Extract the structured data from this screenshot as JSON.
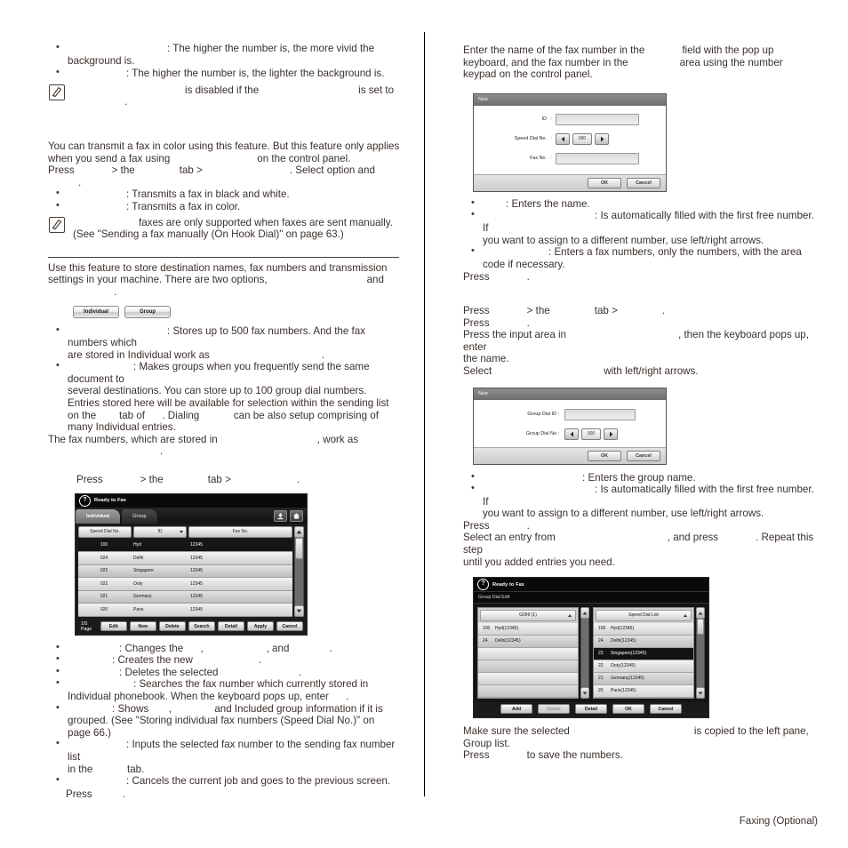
{
  "document": {
    "footer": "Faxing (Optional)"
  },
  "left_column": {
    "bullets_top": [
      {
        "pre_gap": 14,
        "text": ": The higher the number is, the more vivid the background is."
      },
      {
        "pre_gap": 8,
        "text": ": The higher the number is, the lighter the background is."
      }
    ],
    "note_top": {
      "segments": [
        "",
        "is disabled if the",
        "is set to",
        "."
      ]
    },
    "color_mode": {
      "para1": "You can transmit a fax in color using this feature. But this feature only applies when you send a fax using",
      "para1_tail": "on the control panel.",
      "press_line": {
        "press": "Press",
        "gt1": "> the",
        "tab": "tab >",
        "tail": ". Select option and",
        "end": "."
      },
      "bullets": [
        {
          "text": ": Transmits a fax in black and white."
        },
        {
          "text": ": Transmits a fax in color."
        }
      ],
      "note": {
        "line1_tail": "faxes are only supported when faxes are sent manually.",
        "line2": "(See \"Sending a fax manually (On Hook Dial)\" on page 63.)"
      }
    },
    "phonebook": {
      "intro1": "Use this feature to store destination names, fax numbers and transmission",
      "intro2_a": "settings in your machine. There are two options,",
      "intro2_b": "and",
      "intro2_c": ".",
      "figure_buttons": [
        {
          "label": "Individual"
        },
        {
          "label": "Group"
        }
      ],
      "bullets": [
        {
          "lines": [
            ": Stores up to 500 fax numbers. And the fax numbers which",
            "are stored in Individual work as",
            "."
          ]
        },
        {
          "lines": [
            ": Makes groups when you frequently send the same document to",
            "several destinations. You can store up to 100 group dial numbers.",
            "Entries stored here will be available for selection within the sending list",
            "on the        tab of      . Dialing            can be also setup comprising of",
            "many Individual entries."
          ]
        }
      ],
      "closing_a": "The fax numbers, which are stored in",
      "closing_b": ", work as",
      "closing_c": ".",
      "press_line": {
        "press": "Press",
        "gt1": "> the",
        "tab": "tab >",
        "end": "."
      }
    },
    "screenshot_individual": {
      "title": "Ready to Fax",
      "tabs": [
        {
          "label": "Individual",
          "active": true
        },
        {
          "label": "Group",
          "active": false
        }
      ],
      "icons": [
        "export-icon",
        "home-icon"
      ],
      "columns": [
        "Speed Dial No.",
        "ID",
        "Fax No."
      ],
      "rows": [
        {
          "speed_dial": "100",
          "id": "Hyd",
          "fax": "12345",
          "selected": true
        },
        {
          "speed_dial": "024",
          "id": "Delhi",
          "fax": "12345",
          "selected": false
        },
        {
          "speed_dial": "023",
          "id": "Singapore",
          "fax": "12345",
          "selected": false
        },
        {
          "speed_dial": "022",
          "id": "Ooty",
          "fax": "12345",
          "selected": false
        },
        {
          "speed_dial": "021",
          "id": "Germany",
          "fax": "12345",
          "selected": false
        },
        {
          "speed_dial": "020",
          "id": "Paris",
          "fax": "12345",
          "selected": false
        }
      ],
      "page_label": "1/5 Page",
      "buttons": [
        "Edit",
        "New",
        "Delete",
        "Search",
        "Detail",
        "Apply",
        "Cancel"
      ]
    },
    "bullets_bottom": [
      {
        "lines": [
          ": Changes the      ,                      , and              ."
        ]
      },
      {
        "lines": [
          ": Creates the new                       ."
        ]
      },
      {
        "lines": [
          ": Deletes the selected                            ."
        ]
      },
      {
        "lines": [
          ": Searches the fax number which currently stored in",
          "Individual phonebook. When the keyboard pops up, enter      ."
        ]
      },
      {
        "lines": [
          ": Shows       ,               and Included group information if it is",
          "grouped. (See \"Storing individual fax numbers (Speed Dial No.)\" on",
          "page 66.)"
        ]
      },
      {
        "lines": [
          ": Inputs the selected fax number to the sending fax number list",
          "in the            tab."
        ]
      },
      {
        "lines": [
          ": Cancels the current job and goes to the previous screen."
        ]
      }
    ],
    "press_final": {
      "press": "Press",
      "end": "."
    }
  },
  "right_column": {
    "intro": {
      "line1_a": "Enter the name of the fax number in the",
      "line1_b": "field with the pop up",
      "line2_a": "keyboard, and the fax number in the",
      "line2_b": "area using the number",
      "line3": "keypad on the control panel."
    },
    "dialog_new": {
      "title": "New",
      "fields": [
        {
          "label": "ID",
          "type": "text",
          "value": ""
        },
        {
          "label": "Speed Dial No.",
          "type": "spinner",
          "value": "000"
        },
        {
          "label": "Fax No.",
          "type": "text",
          "value": ""
        }
      ],
      "buttons": [
        "OK",
        "Cancel"
      ]
    },
    "bullets_new": [
      {
        "lines": [
          ": Enters the name."
        ]
      },
      {
        "lines": [
          ": Is automatically filled with the first free number. If",
          "you want to assign to a different number, use left/right arrows."
        ]
      },
      {
        "lines": [
          ": Enters a fax numbers, only the numbers, with the area",
          "code if necessary."
        ]
      }
    ],
    "press_after_new": {
      "press": "Press",
      "end": "."
    },
    "group_steps": {
      "press_line": {
        "press": "Press",
        "gt1": "> the",
        "tab": "tab >",
        "end": "."
      },
      "press2": {
        "press": "Press",
        "end": "."
      },
      "line3_a": "Press the input area in",
      "line3_b": ", then the keyboard pops up, enter",
      "line4": "the name.",
      "line5_a": "Select",
      "line5_b": "with left/right arrows."
    },
    "dialog_group_new": {
      "title": "New",
      "fields": [
        {
          "label": "Group Dial ID :",
          "type": "text",
          "value": ""
        },
        {
          "label": "Group Dial No :",
          "type": "spinner",
          "value": "000"
        }
      ],
      "buttons": [
        "OK",
        "Cancel"
      ]
    },
    "bullets_group": [
      {
        "lines": [
          ": Enters the group name."
        ]
      },
      {
        "lines": [
          ": Is automatically filled with the first free number. If",
          "you want to assign to a different number, use left/right arrows."
        ]
      }
    ],
    "press_after_group": {
      "press": "Press",
      "end": "."
    },
    "select_entry": {
      "a": "Select an entry from",
      "b": ", and press",
      "c": ". Repeat this step",
      "d": "until you added entries you need."
    },
    "screenshot_group_dial_edit": {
      "title": "Ready to Fax",
      "subtitle": "Group Dial Edit",
      "left_pane": {
        "header": "G099 (1)",
        "items": [
          {
            "num": "100",
            "label": "Hyd(12345)"
          },
          {
            "num": "24",
            "label": "Delhi(12345)"
          }
        ]
      },
      "right_pane": {
        "header": "Speed Dial List",
        "items": [
          {
            "num": "100",
            "label": "Hyd(12345)",
            "selected": false
          },
          {
            "num": "24",
            "label": "Delhi(12345)",
            "selected": false
          },
          {
            "num": "23",
            "label": "Singapore(12345)",
            "selected": true
          },
          {
            "num": "22",
            "label": "Ooty(12345)",
            "selected": false
          },
          {
            "num": "21",
            "label": "Germany(12345)",
            "selected": false
          },
          {
            "num": "20",
            "label": "Paris(12345)",
            "selected": false
          }
        ]
      },
      "buttons": [
        {
          "label": "Add",
          "disabled": false
        },
        {
          "label": "Delete",
          "disabled": true
        },
        {
          "label": "Detail",
          "disabled": false
        },
        {
          "label": "OK",
          "disabled": false
        },
        {
          "label": "Cancel",
          "disabled": false
        }
      ]
    },
    "closing": {
      "line1_a": "Make sure the selected",
      "line1_b": "is copied to the left pane,",
      "line2": "Group list.",
      "line3_a": "Press",
      "line3_b": "to save the numbers."
    }
  },
  "colors": {
    "text": "#3b302b",
    "lcd_dark": "#0a0a0a",
    "selected_row": "#151515"
  }
}
